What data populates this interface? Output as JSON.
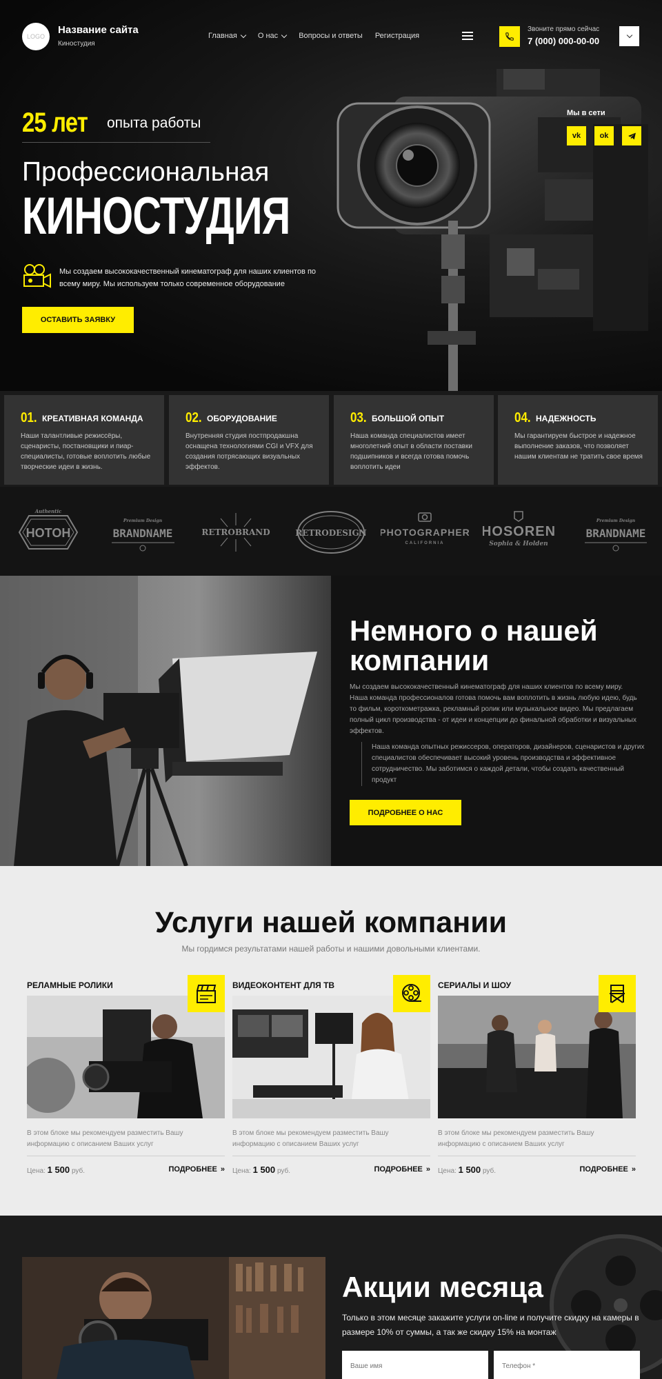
{
  "header": {
    "logo_text": "LOGO",
    "site_name": "Название сайта",
    "site_subtitle": "Киностудия",
    "nav": [
      {
        "label": "Главная",
        "has_dropdown": true
      },
      {
        "label": "О нас",
        "has_dropdown": true
      },
      {
        "label": "Вопросы и ответы",
        "has_dropdown": false
      },
      {
        "label": "Регистрация",
        "has_dropdown": false
      }
    ],
    "phone_caption": "Звоните прямо сейчас",
    "phone_number": "7 (000) 000-00-00",
    "menu_icon": "hamburger-icon",
    "accent_color": "#ffed00"
  },
  "hero": {
    "years_number": "25 лет",
    "years_text": "опыта работы",
    "title_line1": "Профессиональная",
    "title_line2": "КИНОСТУДИЯ",
    "description": "Мы создаем высококачественный кинематограф для наших клиентов по всему миру.  Мы используем только современное оборудование",
    "cta_label": "ОСТАВИТЬ ЗАЯВКУ",
    "social_title": "Мы в сети",
    "socials": [
      {
        "name": "vk-icon",
        "label": "vk"
      },
      {
        "name": "odnoklassniki-icon",
        "label": "ok"
      },
      {
        "name": "telegram-icon",
        "label": "tg"
      }
    ]
  },
  "features": [
    {
      "num": "01.",
      "title": "КРЕАТИВНАЯ КОМАНДА",
      "text": "Наши талантливые режиссёры, сценаристы, постановщики и пиар-специалисты, готовые воплотить любые творческие идеи в жизнь."
    },
    {
      "num": "02.",
      "title": "ОБОРУДОВАНИЕ",
      "text": "Внутренняя студия постпродакшна оснащена технологиями CGI и VFX для создания потрясающих визуальных эффектов."
    },
    {
      "num": "03.",
      "title": "БОЛЬШОЙ ОПЫТ",
      "text": "Наша команда специалистов имеет многолетний опыт в области поставки подшипников и всегда готова помочь воплотить идеи"
    },
    {
      "num": "04.",
      "title": "НАДЕЖНОСТЬ",
      "text": "Мы гарантируем быстрое и надежное выполнение заказов, что позволяет нашим клиентам не тратить свое время"
    }
  ],
  "brands": [
    "HOTOH",
    "BRANDNAME",
    "RETROBRAND",
    "RETRODESIGN",
    "PHOTOGRAPHER",
    "HOSOREN",
    "BRANDNAME"
  ],
  "brand_details": {
    "hoton_top": "Authentic",
    "brandname_top": "Premium Design",
    "photographer_sub": "CALIFORNIA",
    "hosoren_sub": "Sophia & Holden"
  },
  "about": {
    "title": "Немного о нашей компании",
    "paragraph": "Мы создаем высококачественный кинематограф для наших клиентов по всему миру. Наша команда профессионалов готова помочь вам воплотить в жизнь любую идею, будь то фильм, короткометражка, рекламный ролик или музыкальное видео. Мы предлагаем полный цикл производства - от идеи и концепции до финальной обработки и визуальных эффектов.",
    "quote": "Наша команда опытных режиссеров, операторов, дизайнеров, сценаристов и других специалистов обеспечивает высокий уровень производства и эффективное сотрудничество. Мы заботимся о каждой детали, чтобы создать качественный продукт",
    "button_label": "ПОДРОБНЕЕ О НАС"
  },
  "services": {
    "title": "Услуги нашей компании",
    "subtitle": "Мы гордимся результатами нашей работы и нашими довольными клиентами.",
    "items": [
      {
        "title": "РЕЛАМНЫЕ РОЛИКИ",
        "icon": "clapperboard-icon",
        "text": "В этом блоке мы рекомендуем разместить Вашу информацию с описанием Ваших услуг",
        "price_label": "Цена:",
        "price": "1 500",
        "currency": "руб.",
        "more": "ПОДРОБНЕЕ"
      },
      {
        "title": "ВИДЕОКОНТЕНТ ДЛЯ ТВ",
        "icon": "film-reel-icon",
        "text": "В этом блоке мы рекомендуем разместить Вашу информацию с описанием Ваших услуг",
        "price_label": "Цена:",
        "price": "1 500",
        "currency": "руб.",
        "more": "ПОДРОБНЕЕ"
      },
      {
        "title": "СЕРИАЛЫ И ШОУ",
        "icon": "director-chair-icon",
        "text": "В этом блоке мы рекомендуем разместить Вашу информацию с описанием Ваших услуг",
        "price_label": "Цена:",
        "price": "1 500",
        "currency": "руб.",
        "more": "ПОДРОБНЕЕ"
      }
    ]
  },
  "promo": {
    "title": "Акции месяца",
    "text": "Только в этом месяце закажите услуги on-line и получите скидку на камеры в размере 10% от суммы, а так же скидку 15% на монтаж",
    "name_placeholder": "Ваше имя",
    "phone_placeholder": "Телефон *"
  }
}
